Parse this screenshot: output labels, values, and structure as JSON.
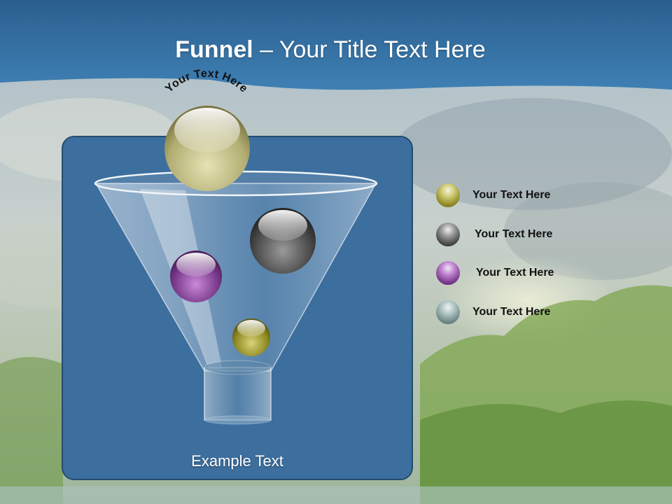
{
  "title": {
    "bold": "Funnel",
    "rest": " – Your Title Text Here"
  },
  "arc_text": "Your Text Here",
  "example_text": "Example Text",
  "legend": [
    {
      "label": "Your  Text Here",
      "color": "#8f8a22"
    },
    {
      "label": "Your  Text Here",
      "color": "#4a4a4a"
    },
    {
      "label": "Your  Text Here",
      "color": "#7a3a8c"
    },
    {
      "label": "Your  Text Here",
      "color": "#6f8a8c"
    }
  ],
  "colors": {
    "header_blue": "#2f6a9c",
    "panel_blue": "#3c6e9e",
    "sky": "#b8c7cf",
    "forest": "#6f9a3a"
  }
}
